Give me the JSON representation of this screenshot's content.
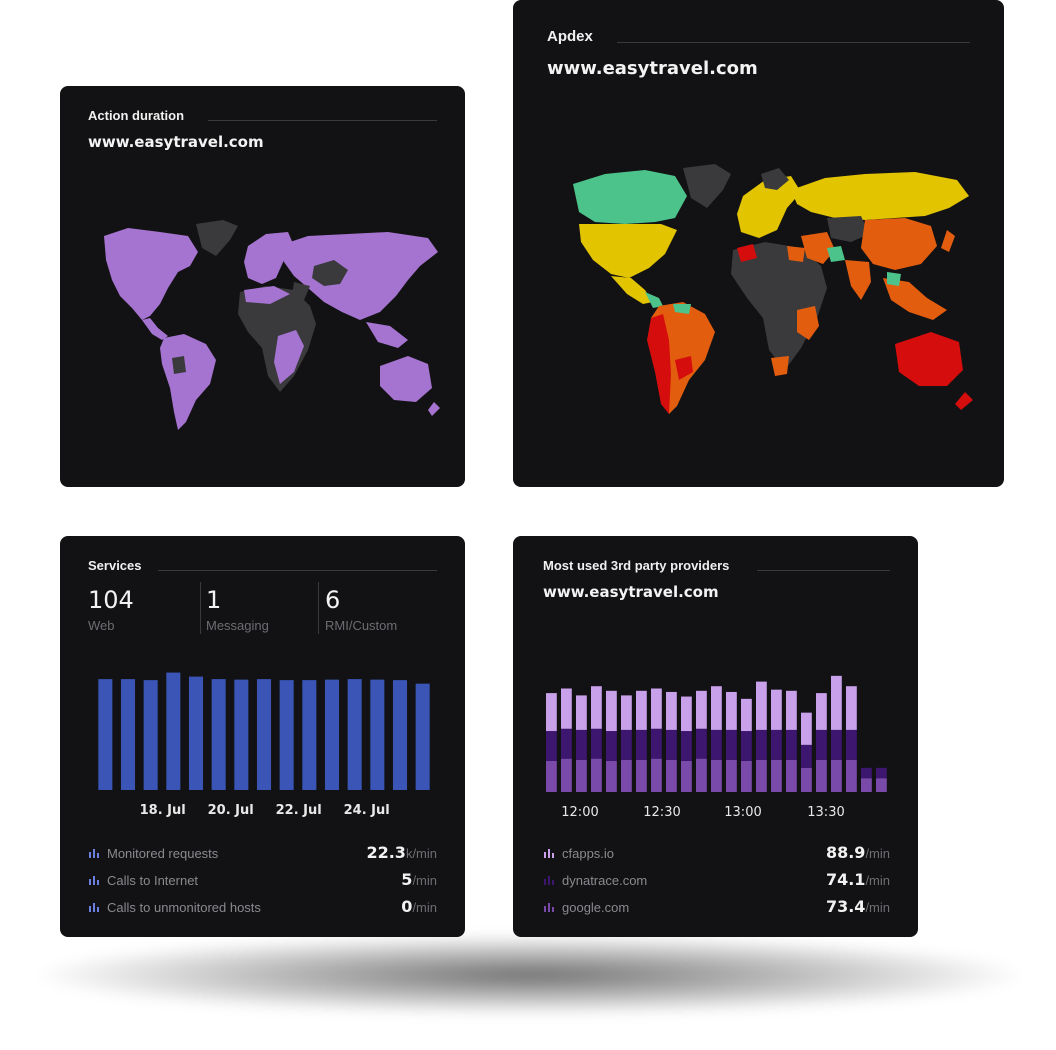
{
  "action_duration": {
    "title": "Action duration",
    "subtitle": "www.easytravel.com",
    "colors": {
      "primary": "#a574d1",
      "no_data": "#3a3a3d"
    }
  },
  "apdex": {
    "title": "Apdex",
    "subtitle": "www.easytravel.com",
    "colors": {
      "excellent": "#4cc38a",
      "good": "#e3c400",
      "fair": "#e35d0f",
      "poor": "#d50d0d",
      "no_data": "#3a3a3d"
    }
  },
  "services": {
    "title": "Services",
    "metrics": [
      {
        "value": "104",
        "label": "Web"
      },
      {
        "value": "1",
        "label": "Messaging"
      },
      {
        "value": "6",
        "label": "RMI/Custom"
      }
    ],
    "bar_color": "#3a55b6",
    "legend": [
      {
        "icon": "bar-chart-icon",
        "label": "Monitored requests",
        "value": "22.3",
        "unit": "k/min"
      },
      {
        "icon": "bar-chart-icon",
        "label": "Calls to Internet",
        "value": "5",
        "unit": "/min"
      },
      {
        "icon": "bar-chart-icon",
        "label": "Calls to unmonitored hosts",
        "value": "0",
        "unit": "/min"
      }
    ]
  },
  "third_party": {
    "title": "Most used 3rd party providers",
    "subtitle": "www.easytravel.com",
    "colors": {
      "cfapps.io": "#c8a1ea",
      "dynatrace.com": "#3d1670",
      "google.com": "#7a4aaa"
    },
    "legend": [
      {
        "icon": "bar-chart-icon",
        "label": "cfapps.io",
        "value": "88.9",
        "unit": "/min"
      },
      {
        "icon": "bar-chart-icon",
        "label": "dynatrace.com",
        "value": "74.1",
        "unit": "/min"
      },
      {
        "icon": "bar-chart-icon",
        "label": "google.com",
        "value": "73.4",
        "unit": "/min"
      }
    ]
  },
  "chart_data": [
    {
      "type": "bar",
      "ticks": [
        "18. Jul",
        "20. Jul",
        "22. Jul",
        "24. Jul"
      ],
      "values": [
        22.0,
        22.0,
        21.8,
        23.3,
        22.5,
        22.0,
        21.9,
        22.0,
        21.8,
        21.8,
        21.9,
        22.0,
        21.9,
        21.8,
        21.1
      ],
      "ylim": [
        0,
        25
      ],
      "grid": false
    },
    {
      "type": "bar",
      "ticks": [
        "12:00",
        "12:30",
        "13:00",
        "13:30"
      ],
      "series": [
        {
          "name": "cfapps.io",
          "values": [
            3.3,
            3.5,
            3.0,
            3.7,
            3.5,
            3.0,
            3.4,
            3.5,
            3.3,
            3.0,
            3.3,
            3.8,
            3.3,
            2.8,
            4.2,
            3.5,
            3.4,
            2.8,
            3.2,
            4.7,
            3.8,
            0.0,
            0.0
          ]
        },
        {
          "name": "dynatrace.com",
          "values": [
            2.6,
            2.6,
            2.6,
            2.6,
            2.6,
            2.6,
            2.6,
            2.6,
            2.6,
            2.6,
            2.6,
            2.6,
            2.6,
            2.6,
            2.6,
            2.6,
            2.6,
            2.0,
            2.6,
            2.6,
            2.6,
            0.9,
            0.9
          ]
        },
        {
          "name": "google.com",
          "values": [
            2.7,
            2.9,
            2.8,
            2.9,
            2.7,
            2.8,
            2.8,
            2.9,
            2.8,
            2.7,
            2.9,
            2.8,
            2.8,
            2.7,
            2.8,
            2.8,
            2.8,
            2.1,
            2.8,
            2.8,
            2.8,
            1.2,
            1.2
          ]
        }
      ],
      "stacked": true,
      "ylim": [
        0,
        12
      ],
      "grid": false
    }
  ]
}
